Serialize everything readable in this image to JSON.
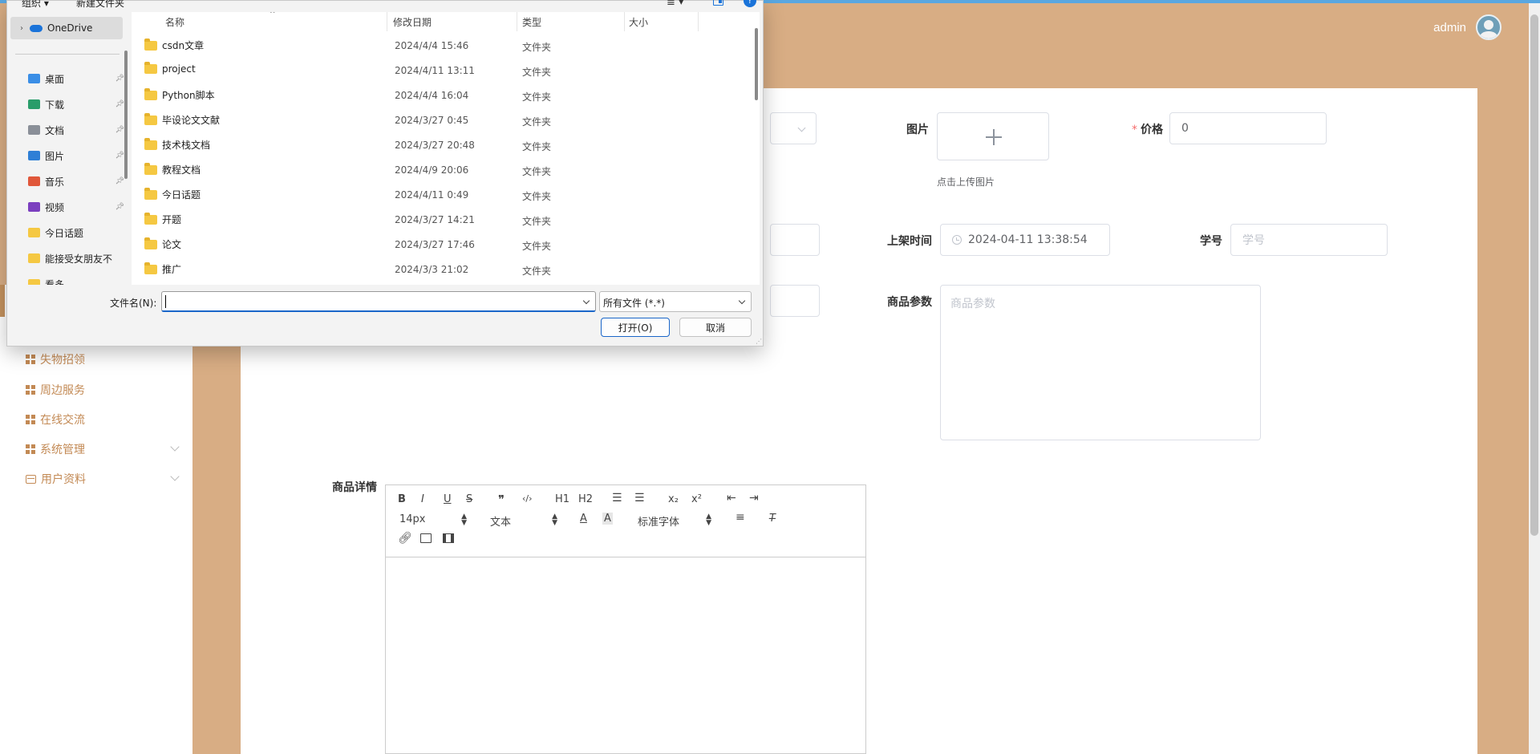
{
  "header": {
    "username": "admin"
  },
  "sidebar": {
    "items": [
      {
        "label": "失物招领",
        "icon": "grid-icon",
        "expandable": false
      },
      {
        "label": "周边服务",
        "icon": "grid-icon",
        "expandable": false
      },
      {
        "label": "在线交流",
        "icon": "grid-icon",
        "expandable": false
      },
      {
        "label": "系统管理",
        "icon": "grid-icon",
        "expandable": true
      },
      {
        "label": "用户资料",
        "icon": "card-icon",
        "expandable": true
      }
    ]
  },
  "form": {
    "image_label": "图片",
    "image_tip": "点击上传图片",
    "price_label": "价格",
    "price_value": "0",
    "listing_time_label": "上架时间",
    "listing_time_value": "2024-04-11 13:38:54",
    "student_id_label": "学号",
    "student_id_placeholder": "学号",
    "params_label": "商品参数",
    "params_placeholder": "商品参数",
    "details_label": "商品详情"
  },
  "editor": {
    "toolbar_row1": [
      "B",
      "I",
      "U",
      "S",
      "❞",
      "‹/›",
      "H1",
      "H2",
      "list-ordered",
      "list-bullet",
      "x₂",
      "x²",
      "outdent",
      "indent"
    ],
    "font_size": "14px",
    "text_type": "文本",
    "font_family": "标准字体"
  },
  "dialog": {
    "organize": "组织 ▾",
    "new_folder": "新建文件夹",
    "nav": {
      "onedrive": "OneDrive",
      "items": [
        {
          "label": "桌面",
          "color": "#3a8ee6",
          "pinned": true
        },
        {
          "label": "下载",
          "color": "#2a9d6a",
          "pinned": true
        },
        {
          "label": "文档",
          "color": "#8a8f98",
          "pinned": true
        },
        {
          "label": "图片",
          "color": "#2f7fd6",
          "pinned": true
        },
        {
          "label": "音乐",
          "color": "#e0573a",
          "pinned": true
        },
        {
          "label": "视频",
          "color": "#7b3fbf",
          "pinned": true
        },
        {
          "label": "今日话题",
          "color": "#f5c842",
          "pinned": false
        },
        {
          "label": "能接受女朋友不",
          "color": "#f5c842",
          "pinned": false
        },
        {
          "label": "看多",
          "color": "#f5c842",
          "pinned": false
        }
      ]
    },
    "columns": {
      "name": "名称",
      "date": "修改日期",
      "type": "类型",
      "size": "大小"
    },
    "files": [
      {
        "name": "csdn文章",
        "date": "2024/4/4 15:46",
        "type": "文件夹"
      },
      {
        "name": "project",
        "date": "2024/4/11 13:11",
        "type": "文件夹"
      },
      {
        "name": "Python脚本",
        "date": "2024/4/4 16:04",
        "type": "文件夹"
      },
      {
        "name": "毕设论文文献",
        "date": "2024/3/27 0:45",
        "type": "文件夹"
      },
      {
        "name": "技术栈文档",
        "date": "2024/3/27 20:48",
        "type": "文件夹"
      },
      {
        "name": "教程文档",
        "date": "2024/4/9 20:06",
        "type": "文件夹"
      },
      {
        "name": "今日话题",
        "date": "2024/4/11 0:49",
        "type": "文件夹"
      },
      {
        "name": "开题",
        "date": "2024/3/27 14:21",
        "type": "文件夹"
      },
      {
        "name": "论文",
        "date": "2024/3/27 17:46",
        "type": "文件夹"
      },
      {
        "name": "推广",
        "date": "2024/3/3 21:02",
        "type": "文件夹"
      }
    ],
    "filename_label": "文件名(N):",
    "filename_value": "",
    "filetype": "所有文件 (*.*)",
    "open_button": "打开(O)",
    "cancel_button": "取消"
  }
}
